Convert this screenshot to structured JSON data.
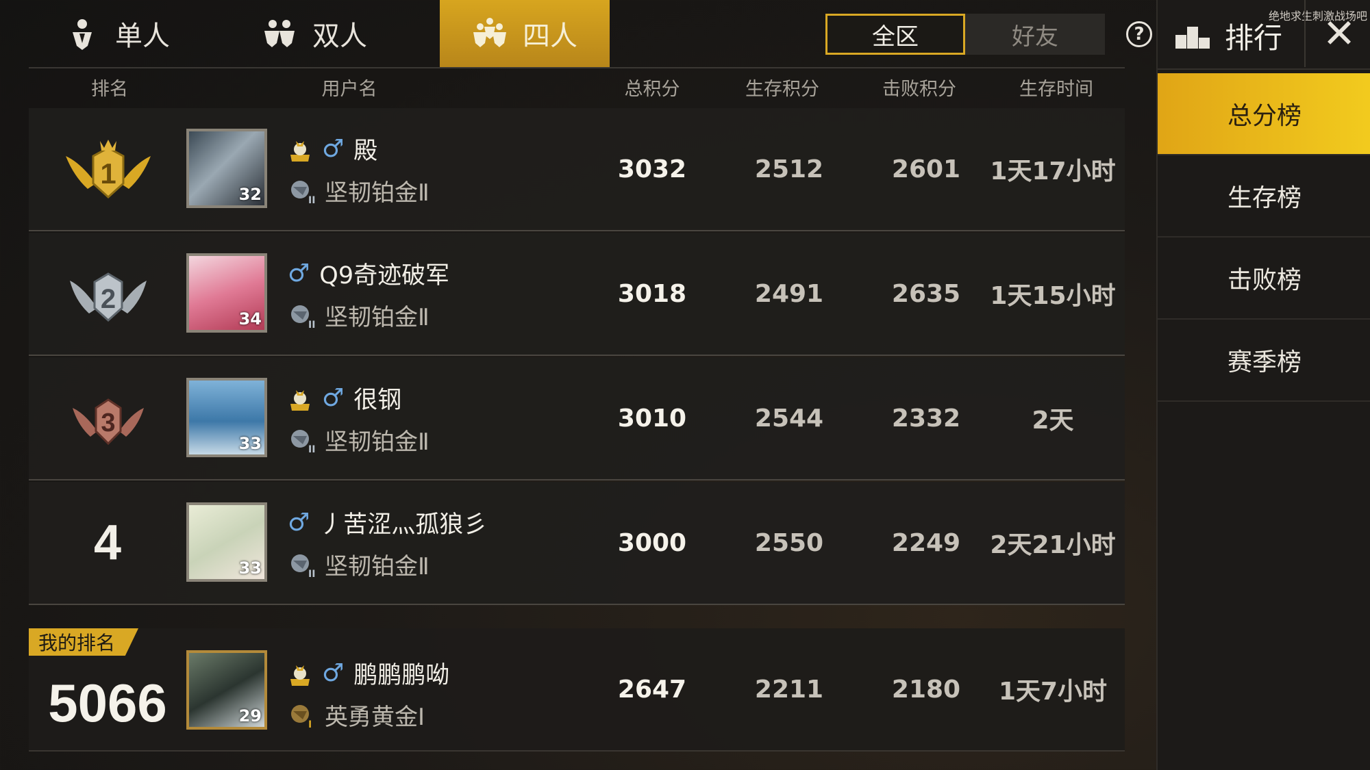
{
  "mode_tabs": [
    {
      "label": "单人",
      "icon": "single-player-icon",
      "active": false
    },
    {
      "label": "双人",
      "icon": "duo-icon",
      "active": false
    },
    {
      "label": "四人",
      "icon": "squad-icon",
      "active": true
    }
  ],
  "scope_tabs": [
    {
      "label": "全区",
      "active": true
    },
    {
      "label": "好友",
      "active": false
    }
  ],
  "help_label": "?",
  "columns": [
    "排名",
    "用户名",
    "总积分",
    "生存积分",
    "击败积分",
    "生存时间"
  ],
  "rows": [
    {
      "rank": "1",
      "level": "32",
      "name": "殿",
      "tier": "坚韧铂金Ⅱ",
      "total": "3032",
      "survival": "2512",
      "kills": "2601",
      "time": "1天17小时"
    },
    {
      "rank": "2",
      "level": "34",
      "name": "Q9奇迹破军",
      "tier": "坚韧铂金Ⅱ",
      "total": "3018",
      "survival": "2491",
      "kills": "2635",
      "time": "1天15小时"
    },
    {
      "rank": "3",
      "level": "33",
      "name": "很钢",
      "tier": "坚韧铂金Ⅱ",
      "total": "3010",
      "survival": "2544",
      "kills": "2332",
      "time": "2天"
    },
    {
      "rank": "4",
      "level": "33",
      "name": "丿苦涩灬孤狼彡",
      "tier": "坚韧铂金Ⅱ",
      "total": "3000",
      "survival": "2550",
      "kills": "2249",
      "time": "2天21小时"
    }
  ],
  "my_rank": {
    "tag": "我的排名",
    "rank": "5066",
    "level": "29",
    "name": "鹏鹏鹏呦",
    "tier": "英勇黄金Ⅰ",
    "total": "2647",
    "survival": "2211",
    "kills": "2180",
    "time": "1天7小时"
  },
  "side_panel": {
    "title": "排行",
    "close": "✕",
    "watermark": "绝地求生刺激战场吧",
    "tabs": [
      "总分榜",
      "生存榜",
      "击败榜",
      "赛季榜"
    ],
    "active_tab": "总分榜"
  },
  "colors": {
    "accent": "#d9a824",
    "male": "#6fa8e0"
  }
}
